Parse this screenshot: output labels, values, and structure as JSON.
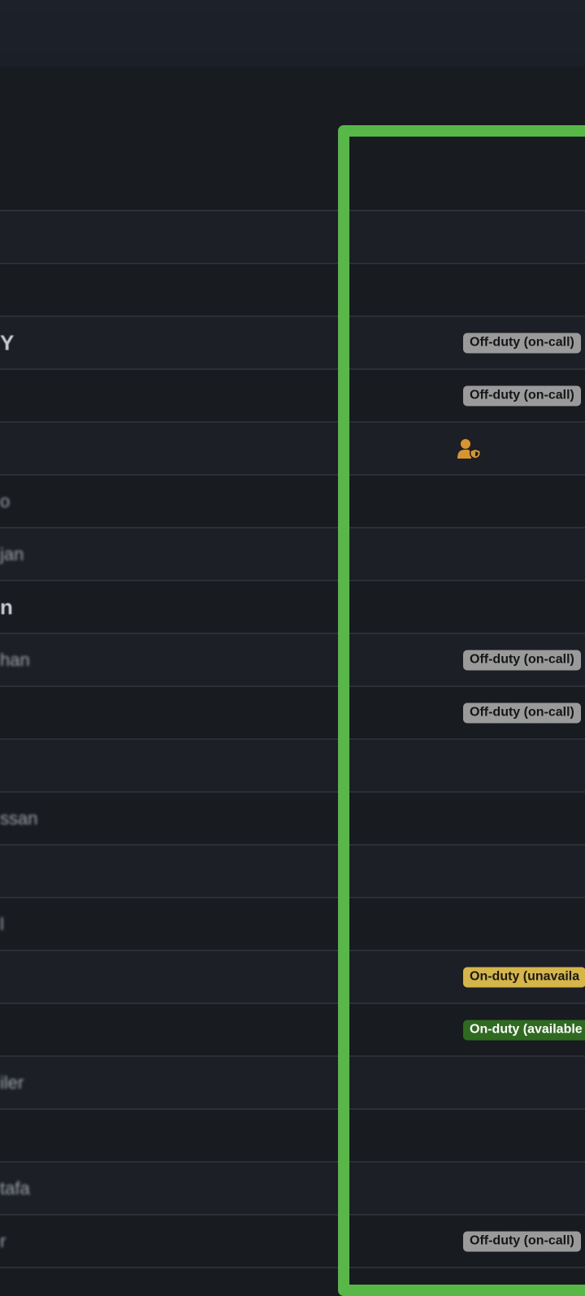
{
  "rows": [
    {
      "name": "",
      "status": ""
    },
    {
      "name": "",
      "status": ""
    },
    {
      "name": "Y",
      "status": "Off-duty (on-call)"
    },
    {
      "name": "",
      "status": "Off-duty (on-call)"
    },
    {
      "name": "",
      "status": "",
      "icon": "user-shield-icon"
    },
    {
      "name": "o",
      "status": ""
    },
    {
      "name": "jan",
      "status": ""
    },
    {
      "name": "n",
      "status": ""
    },
    {
      "name": "han",
      "status": "Off-duty (on-call)"
    },
    {
      "name": "",
      "status": "Off-duty (on-call)"
    },
    {
      "name": "",
      "status": ""
    },
    {
      "name": "ssan",
      "status": ""
    },
    {
      "name": "",
      "status": ""
    },
    {
      "name": "l",
      "status": ""
    },
    {
      "name": "",
      "status": "On-duty (unavaila"
    },
    {
      "name": "",
      "status": "On-duty (available"
    },
    {
      "name": "iler",
      "status": ""
    },
    {
      "name": "",
      "status": ""
    },
    {
      "name": "tafa",
      "status": ""
    },
    {
      "name": "r",
      "status": "Off-duty (on-call)"
    }
  ],
  "colors": {
    "background": "#181b20",
    "highlight": "#58b847",
    "off_duty": "#9a9a9a",
    "on_duty_unavailable": "#d6b54a",
    "on_duty_available": "#2e6a1f",
    "role_icon": "#d6952f"
  }
}
